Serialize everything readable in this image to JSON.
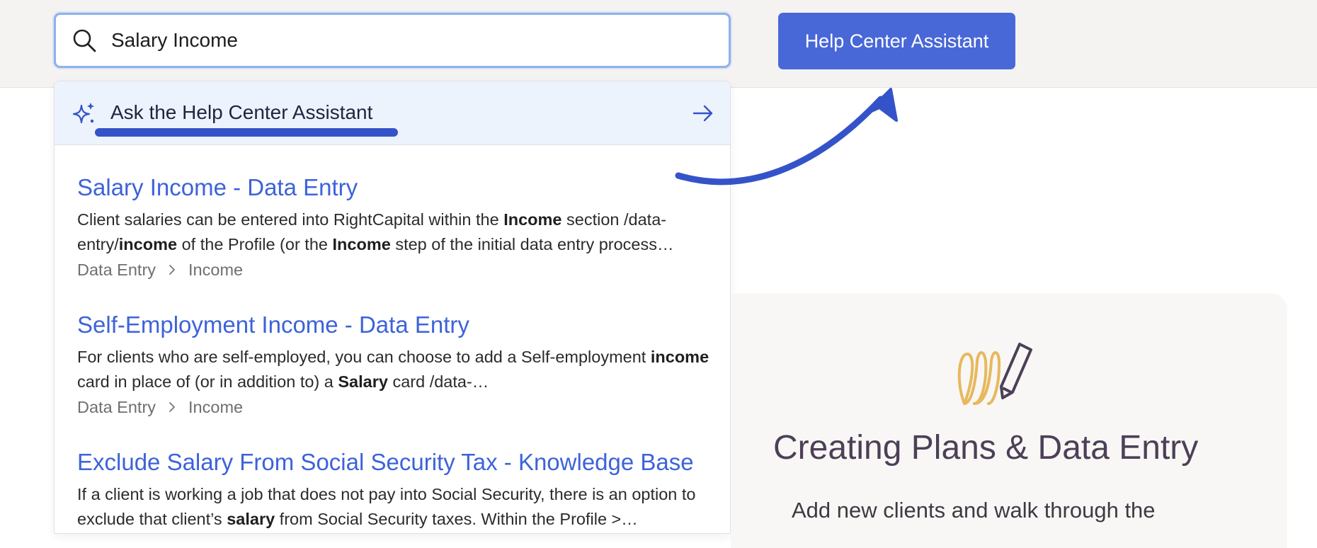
{
  "search": {
    "value": "Salary Income"
  },
  "header": {
    "assistant_button": "Help Center Assistant"
  },
  "dropdown": {
    "ask_label": "Ask the Help Center Assistant",
    "results": [
      {
        "title": "Salary Income - Data Entry",
        "snippet_parts": [
          "Client salaries can be entered into RightCapital within the ",
          "Income",
          " section /data-entry/",
          "income",
          " of the Profile (or the ",
          "Income",
          " step of the initial data entry process…"
        ],
        "crumb_1": "Data Entry",
        "crumb_2": "Income"
      },
      {
        "title": "Self-Employment Income - Data Entry",
        "snippet_parts": [
          "For clients who are self-employed, you can choose to add a Self-employment ",
          "income",
          " card in place of (or in addition to) a ",
          "Salary",
          " card /data-…"
        ],
        "crumb_1": "Data Entry",
        "crumb_2": "Income"
      },
      {
        "title": "Exclude Salary From Social Security Tax - Knowledge Base",
        "snippet_parts": [
          "If a client is working a job that does not pay into Social Security, there is an option to exclude that client’s ",
          "salary",
          " from Social Security taxes. Within the Profile >…"
        ]
      }
    ]
  },
  "card": {
    "title": "Creating Plans & Data Entry",
    "description": "Add new clients and walk through the"
  },
  "colors": {
    "accent": "#4868d8",
    "link": "#3d63d8",
    "annotation": "#3553c9",
    "card_icon_gold": "#e7b85c",
    "card_icon_purple": "#4c3f57"
  }
}
